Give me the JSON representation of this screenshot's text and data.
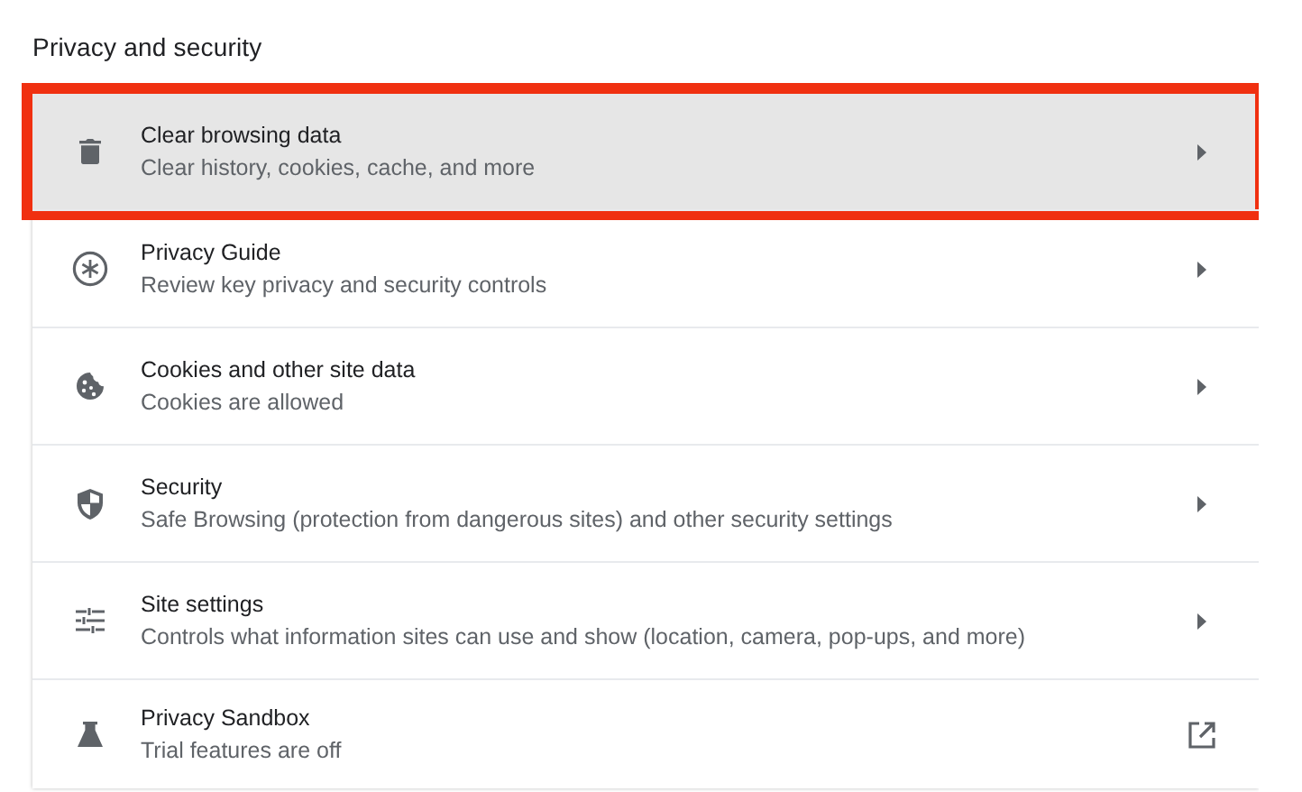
{
  "section_title": "Privacy and security",
  "items": [
    {
      "kind": "trash",
      "title": "Clear browsing data",
      "subtitle": "Clear history, cookies, cache, and more",
      "opens_externally": false,
      "highlighted": true,
      "outlined": true
    },
    {
      "kind": "guide",
      "title": "Privacy Guide",
      "subtitle": "Review key privacy and security controls",
      "opens_externally": false,
      "highlighted": false,
      "outlined": false
    },
    {
      "kind": "cookie",
      "title": "Cookies and other site data",
      "subtitle": "Cookies are allowed",
      "opens_externally": false,
      "highlighted": false,
      "outlined": false
    },
    {
      "kind": "shield",
      "title": "Security",
      "subtitle": "Safe Browsing (protection from dangerous sites) and other security settings",
      "opens_externally": false,
      "highlighted": false,
      "outlined": false
    },
    {
      "kind": "tune",
      "title": "Site settings",
      "subtitle": "Controls what information sites can use and show (location, camera, pop-ups, and more)",
      "opens_externally": false,
      "highlighted": false,
      "outlined": false
    },
    {
      "kind": "flask",
      "title": "Privacy Sandbox",
      "subtitle": "Trial features are off",
      "opens_externally": true,
      "highlighted": false,
      "outlined": false
    }
  ]
}
